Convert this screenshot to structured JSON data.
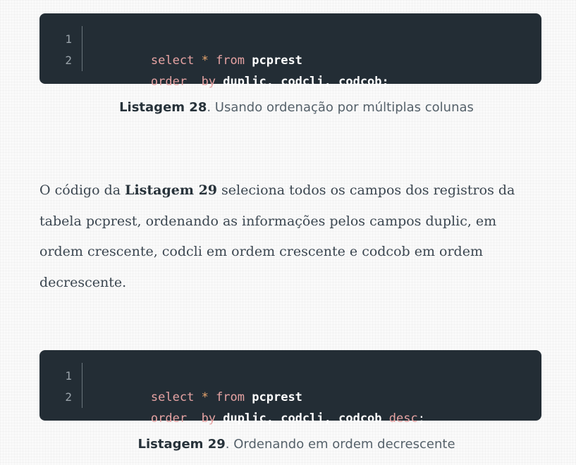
{
  "listing28": {
    "lines": [
      {
        "num": "1",
        "tokens": [
          "select",
          "*",
          "from",
          "pcprest"
        ]
      },
      {
        "num": "2",
        "tokens": [
          "order",
          "by",
          "duplic,",
          "codcli,",
          "codcob;"
        ]
      }
    ],
    "caption_bold": "Listagem 28",
    "caption_rest": ". Usando ordenação por múltiplas colunas"
  },
  "paragraph": {
    "part1": "O código da ",
    "bold": "Listagem 29",
    "part2": " seleciona todos os campos dos registros da tabela pcprest, ordenando as informações pelos campos duplic, em ordem crescente, codcli em ordem crescente e codcob em ordem decrescente."
  },
  "listing29": {
    "lines": [
      {
        "num": "1",
        "tokens": [
          "select",
          "*",
          "from",
          "pcprest"
        ]
      },
      {
        "num": "2",
        "tokens": [
          "order",
          "by",
          "duplic,",
          "codcli,",
          "codcob",
          "desc",
          ";"
        ]
      }
    ],
    "caption_bold": "Listagem 29",
    "caption_rest": ". Ordenando em ordem decrescente"
  },
  "colors": {
    "code_bg": "#232d35",
    "keyword": "#e6a3a3",
    "operator": "#e9a66e",
    "identifier": "#ffffff"
  }
}
